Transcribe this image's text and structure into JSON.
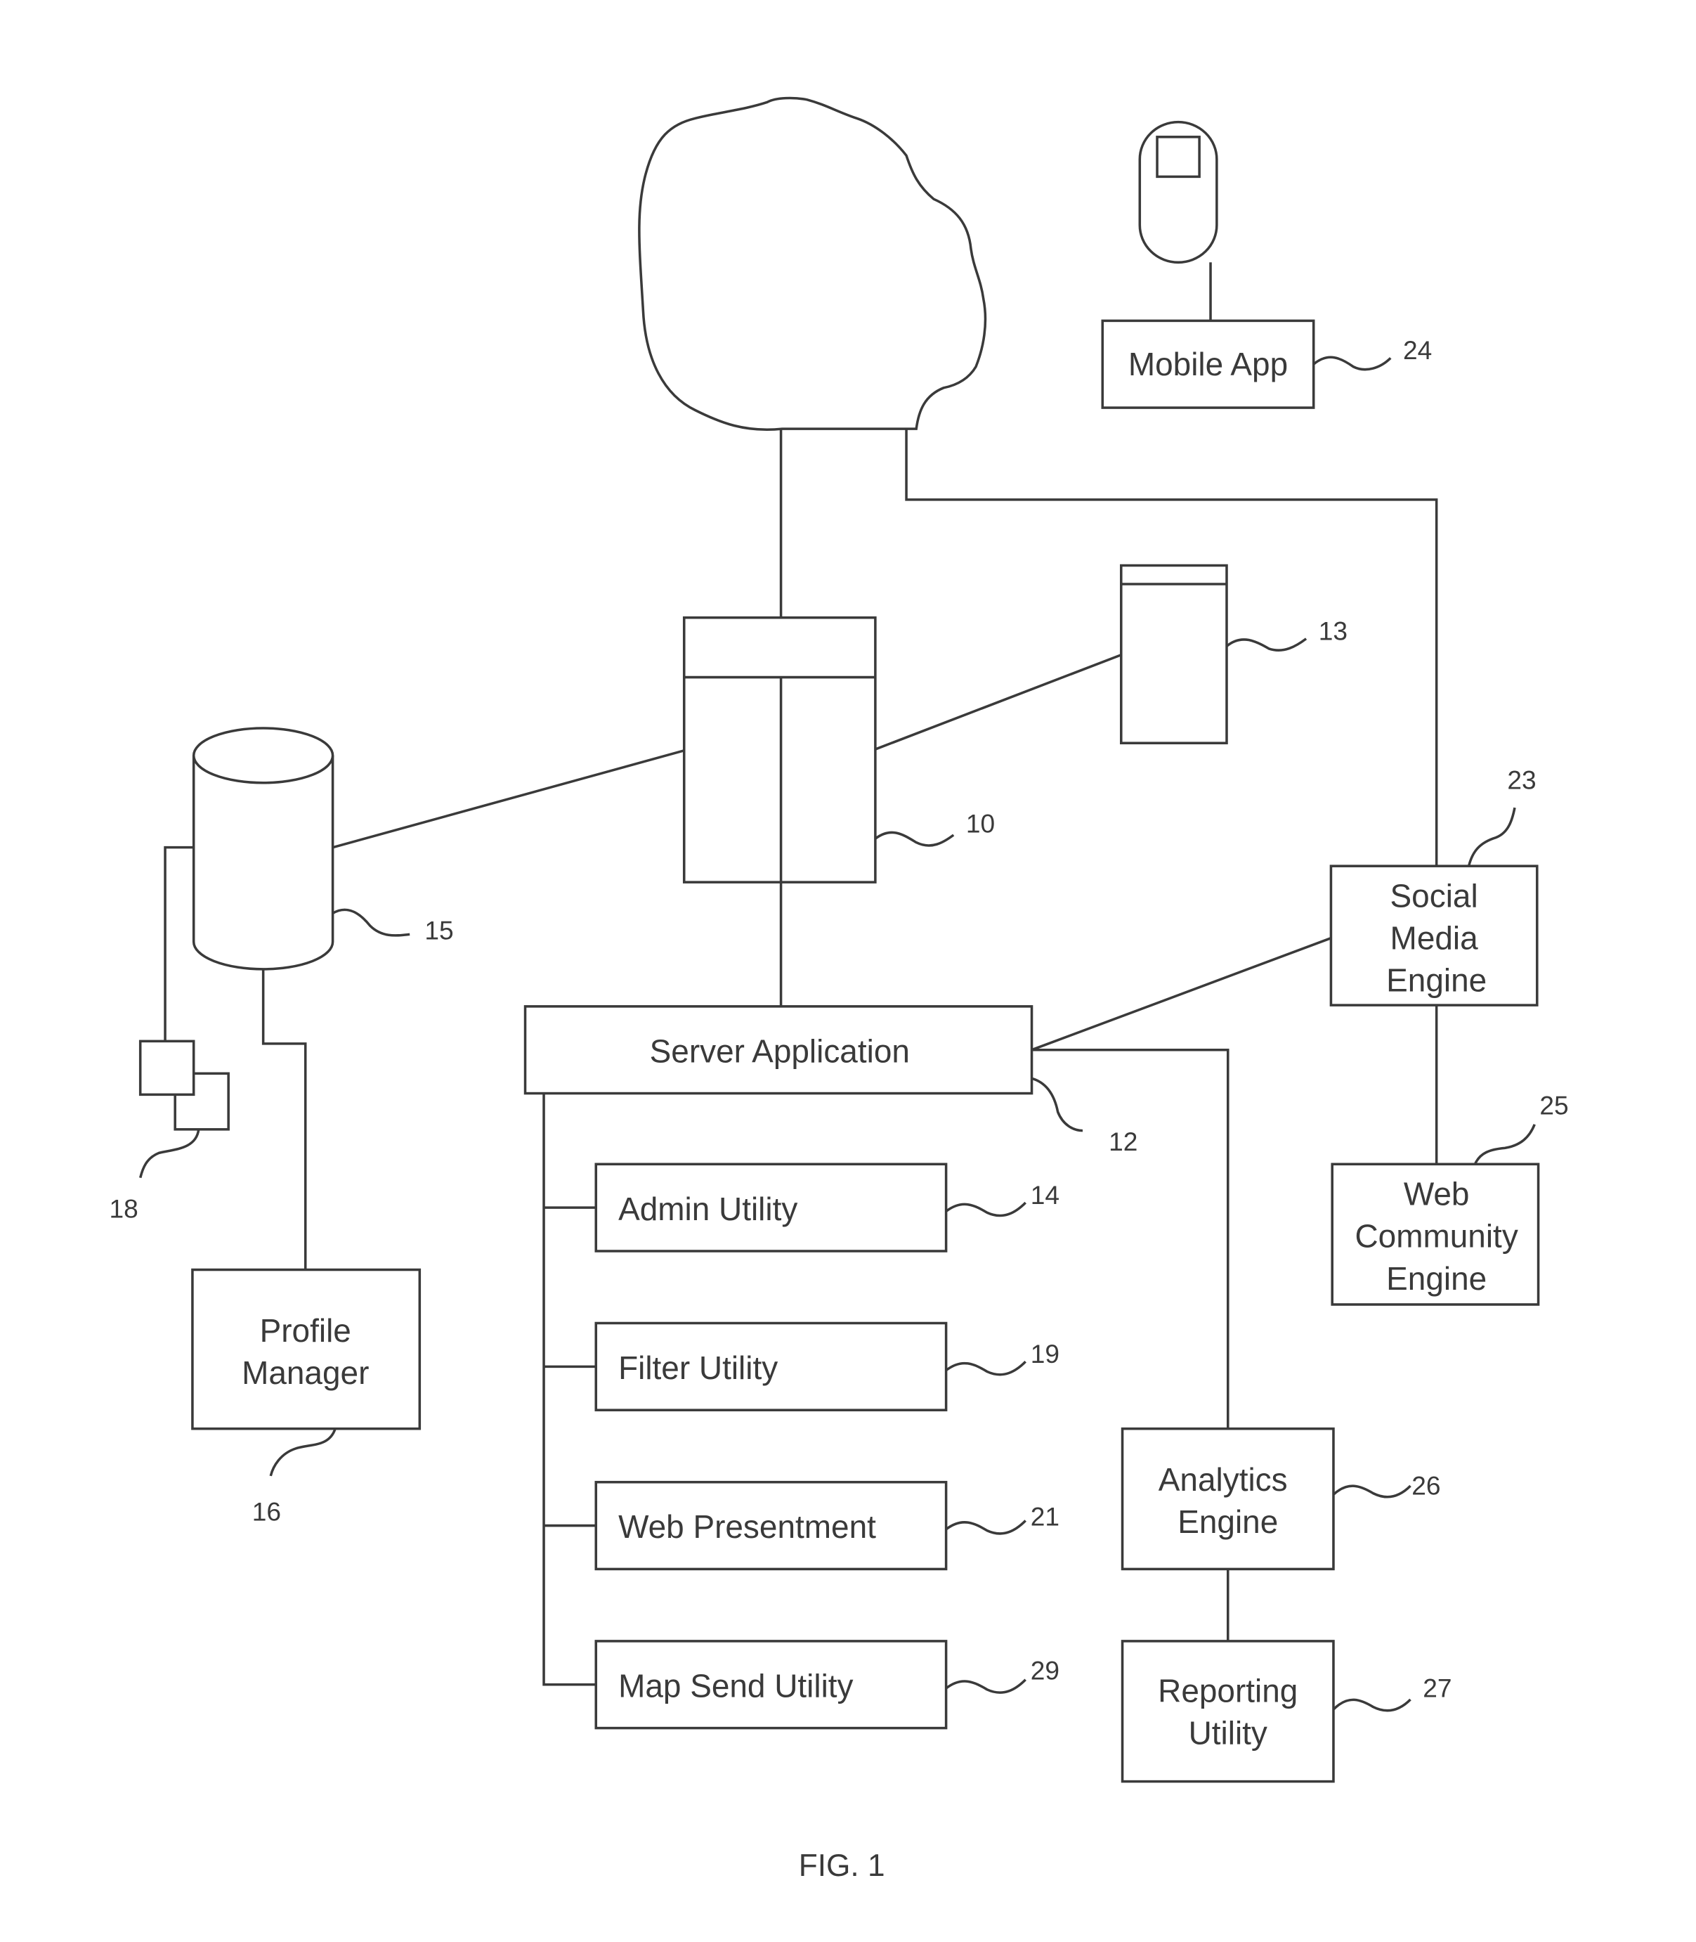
{
  "figure": {
    "caption": "FIG. 1",
    "nodes": {
      "network_cloud": {
        "ref": ""
      },
      "mobile_device": {
        "ref": ""
      },
      "mobile_app": {
        "label": "Mobile App",
        "ref": "24"
      },
      "server": {
        "ref": "10"
      },
      "client_device": {
        "ref": "13"
      },
      "database": {
        "ref": "15"
      },
      "terminals": {
        "ref": "18"
      },
      "profile_manager": {
        "line1": "Profile",
        "line2": "Manager",
        "ref": "16"
      },
      "server_application": {
        "label": "Server Application",
        "ref": "12"
      },
      "admin_utility": {
        "label": "Admin Utility",
        "ref": "14"
      },
      "filter_utility": {
        "label": "Filter Utility",
        "ref": "19"
      },
      "web_presentment": {
        "label": "Web Presentment",
        "ref": "21"
      },
      "map_send_utility": {
        "label": "Map Send Utility",
        "ref": "29"
      },
      "social_media_engine": {
        "line1": "Social",
        "line2": "Media",
        "line3": "Engine",
        "ref": "23"
      },
      "web_community_engine": {
        "line1": "Web",
        "line2": "Community",
        "line3": "Engine",
        "ref": "25"
      },
      "analytics_engine": {
        "line1": "Analytics",
        "line2": "Engine",
        "ref": "26"
      },
      "reporting_utility": {
        "line1": "Reporting",
        "line2": "Utility",
        "ref": "27"
      }
    }
  }
}
